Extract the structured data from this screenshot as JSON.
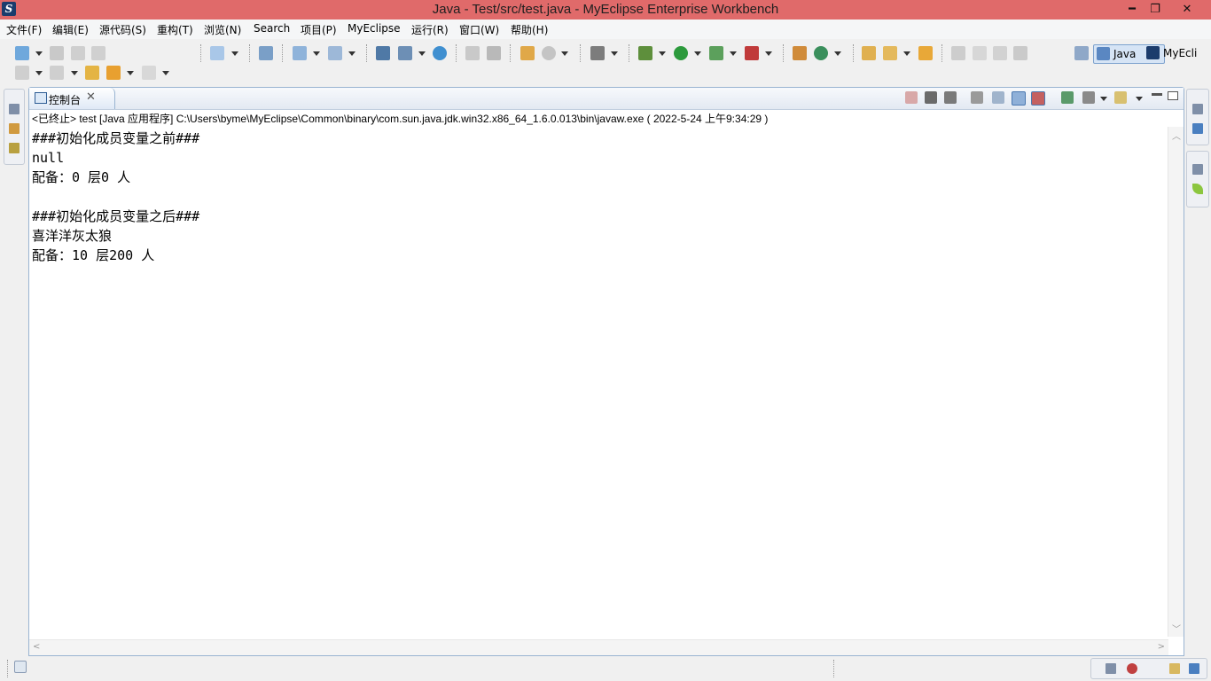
{
  "window": {
    "title": "Java  -  Test/src/test.java  -  MyEclipse Enterprise Workbench",
    "app_icon": "myeclipse-logo-icon",
    "minimize": "━",
    "restore": "❐",
    "close": "✕"
  },
  "menu": {
    "items": [
      "文件(F)",
      "编辑(E)",
      "源代码(S)",
      "重构(T)",
      "浏览(N)",
      "Search",
      "项目(P)",
      "MyEclipse",
      "运行(R)",
      "窗口(W)",
      "帮助(H)"
    ]
  },
  "perspectives": [
    {
      "label": "Java",
      "active": true,
      "icon": "java-perspective-icon"
    },
    {
      "label": "MyEcli",
      "active": false,
      "icon": "myeclipse-perspective-icon"
    }
  ],
  "console": {
    "tab_label": "控制台",
    "tab_close": "✕",
    "status_line": "<已终止> test [Java 应用程序] C:\\Users\\byme\\MyEclipse\\Common\\binary\\com.sun.java.jdk.win32.x86_64_1.6.0.013\\bin\\javaw.exe ( 2022-5-24 上午9:34:29 )",
    "lines": [
      "###初始化成员变量之前###",
      "null",
      "配备：0 层0 人",
      "",
      "###初始化成员变量之后###",
      "喜洋洋灰太狼",
      "配备：10 层200 人"
    ]
  },
  "colors": {
    "titlebar": "#e06a6a",
    "view_border": "#99b4d1",
    "accent": "#2d5c94"
  }
}
